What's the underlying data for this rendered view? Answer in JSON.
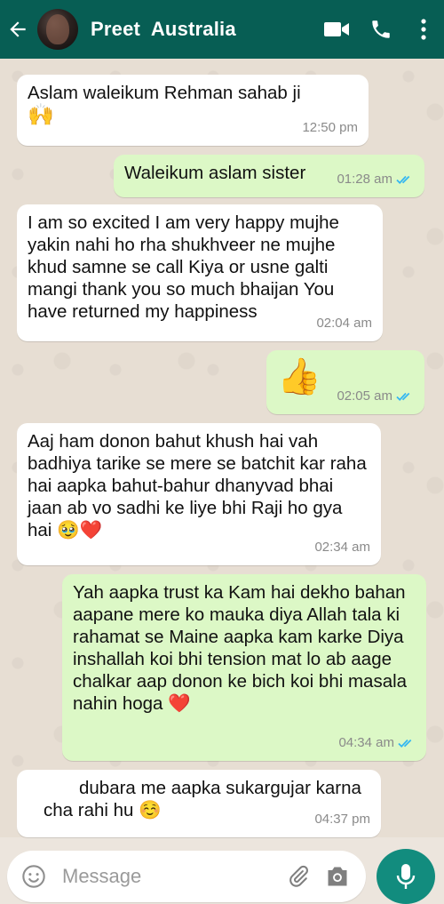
{
  "header": {
    "contact_name": "Preet  Australia",
    "icons": [
      "back-arrow-icon",
      "video-call-icon",
      "phone-icon",
      "more-vert-icon"
    ]
  },
  "messages": [
    {
      "dir": "in",
      "text": "Aslam waleikum Rehman sahab ji",
      "emoji": "🙌",
      "time": "12:50 pm"
    },
    {
      "dir": "out",
      "text": "Waleikum aslam sister",
      "time": "01:28 am",
      "read": true
    },
    {
      "dir": "in",
      "text": "I am so excited I am very happy mujhe yakin nahi ho rha shukhveer ne mujhe khud samne se call Kiya or usne galti mangi thank you so much bhaijan You have returned my happiness",
      "time": "02:04 am"
    },
    {
      "dir": "out",
      "emoji": "👍",
      "time": "02:05 am",
      "read": true
    },
    {
      "dir": "in",
      "text": "Aaj ham donon bahut khush hai vah badhiya tarike se mere se batchit kar raha hai aapka bahut-bahur dhanyvad bhai jaan ab vo sadhi ke liye  bhi Raji ho gya hai",
      "emoji": "🥹❤️",
      "time": "02:34 am"
    },
    {
      "dir": "out",
      "text": "Yah aapka trust ka Kam hai dekho bahan aapane mere ko mauka diya Allah tala ki rahamat se Maine aapka kam karke Diya inshallah koi bhi tension mat lo ab aage chalkar aap donon ke bich koi bhi masala nahin hoga",
      "emoji": "❤️",
      "time": "04:34 am",
      "read": true
    },
    {
      "dir": "in",
      "text": "dubara me aapka sukargujar karna cha rahi hu",
      "emoji": "☺️",
      "time": "04:37 pm"
    }
  ],
  "composer": {
    "placeholder": "Message",
    "icons": [
      "emoji-icon",
      "attach-icon",
      "camera-icon",
      "mic-icon"
    ]
  },
  "colors": {
    "header": "#075E54",
    "outgoing_bubble": "#DCF8C6",
    "incoming_bubble": "#FFFFFF",
    "read_ticks": "#34B7F1",
    "mic_button": "#128C7E"
  }
}
